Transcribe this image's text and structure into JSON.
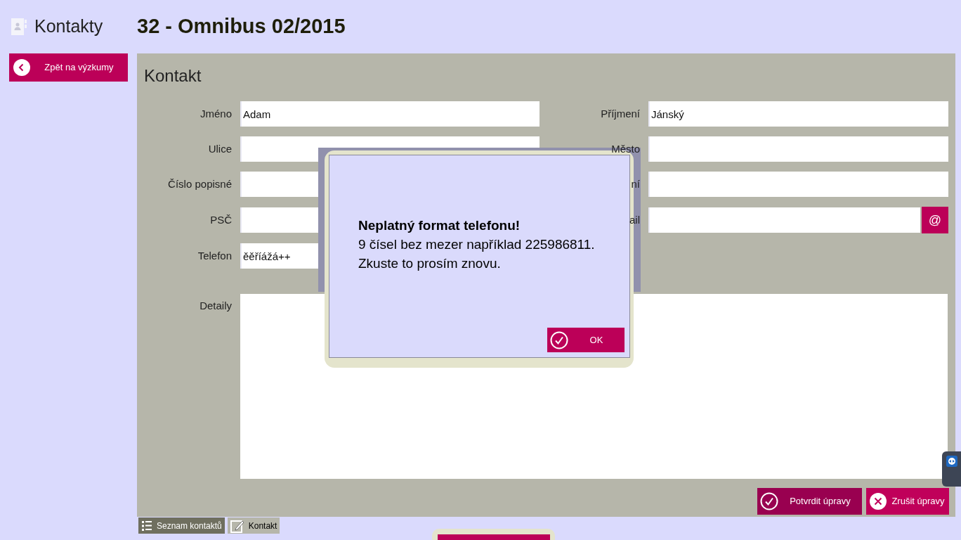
{
  "header": {
    "section": "Kontakty",
    "title": "32 - Omnibus 02/2015"
  },
  "back_button": "Zpět na výzkumy",
  "panel": {
    "title": "Kontakt"
  },
  "rows": [
    [
      {
        "label": "Jméno",
        "value": "Adam",
        "kind": "text"
      },
      {
        "label": "Příjmení",
        "value": "Jánský",
        "kind": "text"
      }
    ],
    [
      {
        "label": "Ulice",
        "kind": "text"
      },
      {
        "label": "Město",
        "kind": "text"
      }
    ],
    [
      {
        "label": "Číslo popisné",
        "kind": "text"
      },
      {
        "label": "ní",
        "kind": "text"
      }
    ],
    [
      {
        "label": "PSČ",
        "kind": "text"
      },
      {
        "label": "ail",
        "kind": "email",
        "button": "@"
      }
    ],
    [
      {
        "label": "Telefon",
        "value": "ěěříážá++",
        "kind": "text"
      }
    ]
  ],
  "detail": {
    "label": "Detaily"
  },
  "actions": [
    {
      "label": "Potvrdit úpravy",
      "kind": "confirm"
    },
    {
      "label": "Zrušit úpravy",
      "kind": "cancel"
    }
  ],
  "tabs": [
    {
      "label": "Seznam kontaktů",
      "selected": false
    },
    {
      "label": "Kontakt",
      "selected": true
    }
  ],
  "dialog": {
    "heading": "Neplatný format telefonu!",
    "lines": [
      "9 čísel bez mezer například 225986811.",
      "Zkuste to prosím znovu."
    ],
    "button": "OK"
  }
}
